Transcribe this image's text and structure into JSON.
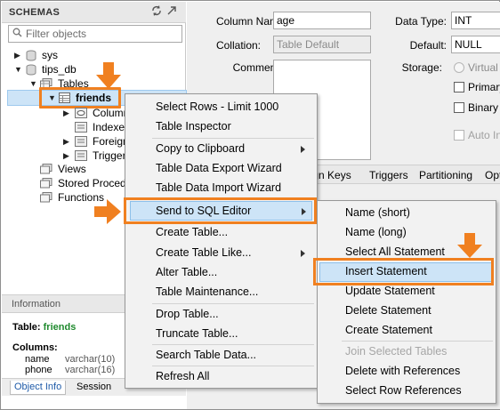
{
  "sidebar": {
    "title": "SCHEMAS",
    "filter_placeholder": "Filter objects",
    "tree": {
      "sys": "sys",
      "tips_db": "tips_db",
      "tables": "Tables",
      "friends": "friends",
      "columns": "Column",
      "indexes": "Indexe",
      "foreign": "Foreign",
      "triggers": "Trigger",
      "views": "Views",
      "procedures": "Stored Procedu",
      "functions": "Functions"
    }
  },
  "info": {
    "header": "Information",
    "table_label": "Table:",
    "table_name": "friends",
    "columns_label": "Columns:",
    "columns": [
      {
        "name": "name",
        "type": "varchar(10)"
      },
      {
        "name": "phone",
        "type": "varchar(16)"
      }
    ],
    "tabs": [
      "Object Info",
      "Session"
    ]
  },
  "editor": {
    "column_name_label": "Column Name:",
    "column_name_value": "age",
    "collation_label": "Collation:",
    "collation_value": "Table Default",
    "comments_label": "Comments:",
    "data_type_label": "Data Type:",
    "data_type_value": "INT",
    "default_label": "Default:",
    "default_value": "NULL",
    "storage_label": "Storage:",
    "storage_virtual": "Virtual",
    "primary_label": "Primary",
    "binary_label": "Binary",
    "auto_label": "Auto In",
    "tabs": [
      "eign Keys",
      "Triggers",
      "Partitioning",
      "Opt"
    ]
  },
  "context_menu": {
    "items": [
      "Select Rows - Limit 1000",
      "Table Inspector",
      "Copy to Clipboard",
      "Table Data Export Wizard",
      "Table Data Import Wizard",
      "Send to SQL Editor",
      "Create Table...",
      "Create Table Like...",
      "Alter Table...",
      "Table Maintenance...",
      "Drop Table...",
      "Truncate Table...",
      "Search Table Data...",
      "Refresh All"
    ]
  },
  "submenu": {
    "items": [
      "Name (short)",
      "Name (long)",
      "Select All Statement",
      "Insert Statement",
      "Update Statement",
      "Delete Statement",
      "Create Statement",
      "Join Selected Tables",
      "Delete with References",
      "Select Row References"
    ]
  },
  "colors": {
    "highlight_orange": "#f08020",
    "selection_blue": "#cde4f7",
    "table_name_green": "#1f8a2e"
  }
}
